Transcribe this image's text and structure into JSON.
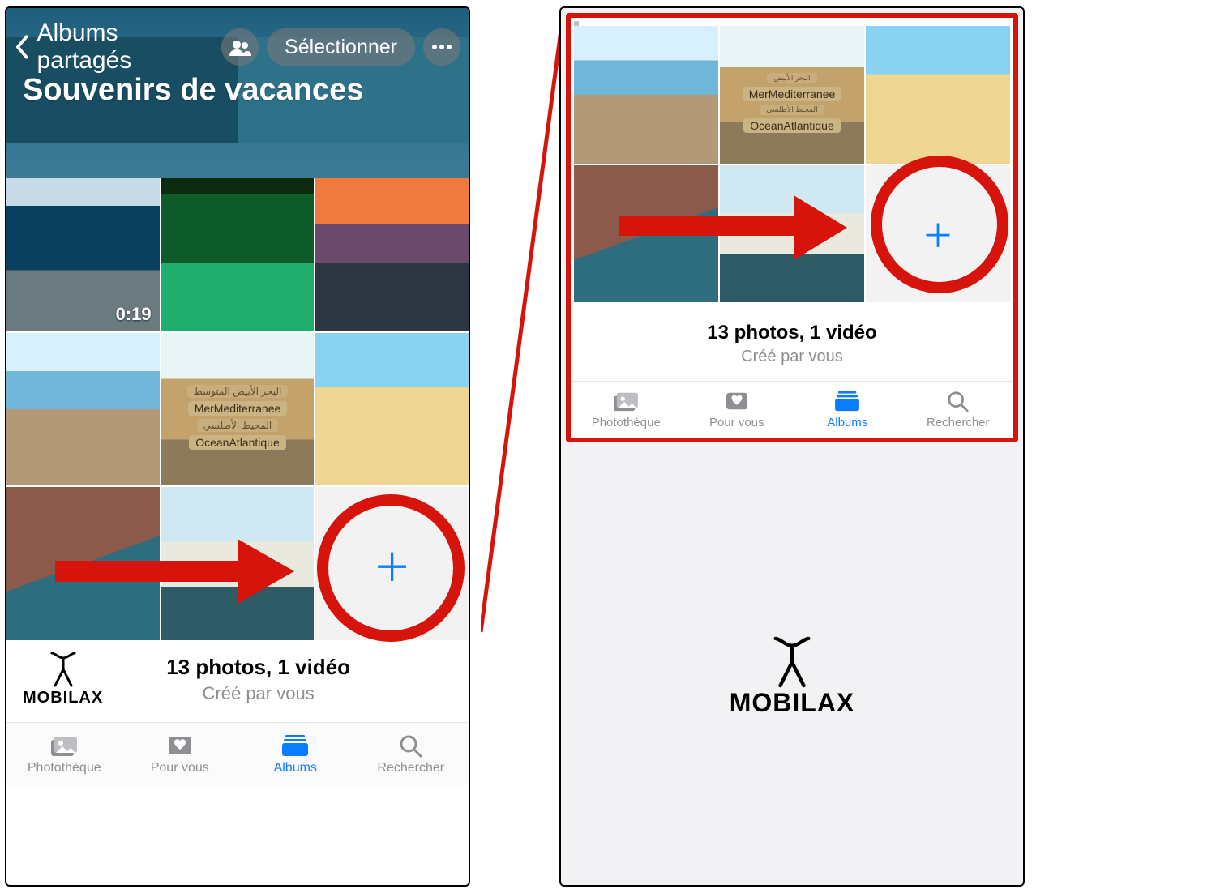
{
  "left": {
    "nav": {
      "back_label": "Albums partagés",
      "select_label": "Sélectionner"
    },
    "album_title": "Souvenirs de vacances",
    "video_badge": "0:19",
    "signs": {
      "line2": "MerMediterranee",
      "line4": "OceanAtlantique"
    },
    "summary": {
      "line1": "13 photos, 1 vidéo",
      "line2": "Créé par vous"
    },
    "logo_word": "MOBILAX",
    "tabs": {
      "library": "Photothèque",
      "foryou": "Pour vous",
      "albums": "Albums",
      "search": "Rechercher"
    }
  },
  "right": {
    "signs": {
      "line2": "MerMediterranee",
      "line4": "OceanAtlantique"
    },
    "summary": {
      "line1": "13 photos, 1 vidéo",
      "line2": "Créé par vous"
    },
    "tabs": {
      "library": "Photothèque",
      "foryou": "Pour vous",
      "albums": "Albums",
      "search": "Rechercher"
    },
    "logo_word": "MOBILAX"
  }
}
